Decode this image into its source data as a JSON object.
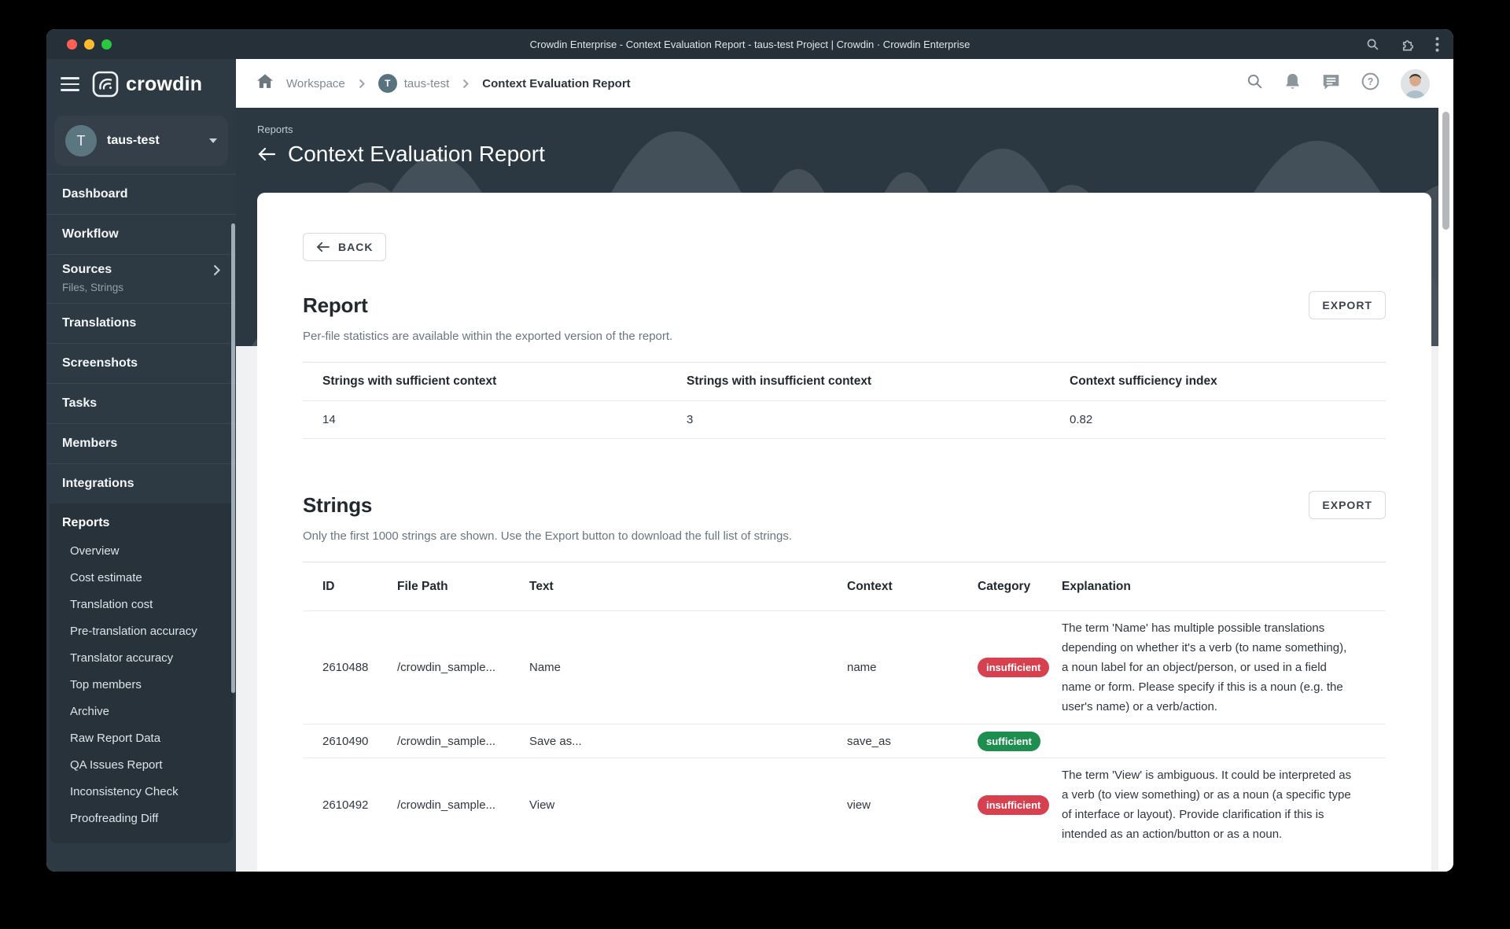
{
  "browser": {
    "title": "Crowdin Enterprise - Context Evaluation Report - taus-test Project | Crowdin · Crowdin Enterprise",
    "traffic_colors": {
      "close": "#ff5f57",
      "minimize": "#febc2e",
      "zoom": "#28c840"
    }
  },
  "app_header": {
    "breadcrumb": {
      "workspace": "Workspace",
      "project": "taus-test",
      "project_initial": "T",
      "current": "Context Evaluation Report"
    }
  },
  "sidebar": {
    "logo_text": "crowdin",
    "project": {
      "initial": "T",
      "name": "taus-test"
    },
    "items": [
      {
        "label": "Dashboard"
      },
      {
        "label": "Workflow"
      },
      {
        "label": "Sources",
        "subtitle": "Files, Strings"
      },
      {
        "label": "Translations"
      },
      {
        "label": "Screenshots"
      },
      {
        "label": "Tasks"
      },
      {
        "label": "Members"
      },
      {
        "label": "Integrations"
      }
    ],
    "reports": {
      "label": "Reports",
      "children": [
        "Overview",
        "Cost estimate",
        "Translation cost",
        "Pre-translation accuracy",
        "Translator accuracy",
        "Top members",
        "Archive",
        "Raw Report Data",
        "QA Issues Report",
        "Inconsistency Check",
        "Proofreading Diff"
      ]
    }
  },
  "page_header": {
    "eyebrow": "Reports",
    "title": "Context Evaluation Report"
  },
  "content": {
    "back_label": "BACK",
    "report": {
      "title": "Report",
      "export_label": "EXPORT",
      "subtitle": "Per-file statistics are available within the exported version of the report.",
      "stats": {
        "headers": [
          "Strings with sufficient context",
          "Strings with insufficient context",
          "Context sufficiency index"
        ],
        "values": [
          "14",
          "3",
          "0.82"
        ]
      }
    },
    "strings": {
      "title": "Strings",
      "export_label": "EXPORT",
      "subtitle": "Only the first 1000 strings are shown. Use the Export button to download the full list of strings.",
      "columns": [
        "ID",
        "File Path",
        "Text",
        "Context",
        "Category",
        "Explanation"
      ],
      "rows": [
        {
          "id": "2610488",
          "file_path": "/crowdin_sample...",
          "text": "Name",
          "context": "name",
          "category": "insufficient",
          "explanation": "The term 'Name' has multiple possible translations depending on whether it's a verb (to name something), a noun label for an object/person, or used in a field name or form. Please specify if this is a noun (e.g. the user's name) or a verb/action."
        },
        {
          "id": "2610490",
          "file_path": "/crowdin_sample...",
          "text": "Save as...",
          "context": "save_as",
          "category": "sufficient",
          "explanation": ""
        },
        {
          "id": "2610492",
          "file_path": "/crowdin_sample...",
          "text": "View",
          "context": "view",
          "category": "insufficient",
          "explanation": "The term 'View' is ambiguous. It could be interpreted as a verb (to view something) or as a noun (a specific type of interface or layout). Provide clarification if this is intended as an action/button or as a noun."
        }
      ]
    }
  },
  "colors": {
    "badge_insufficient": "#d6404f",
    "badge_sufficient": "#1d8e4e",
    "sidebar_bg": "#2d3a43",
    "banner_bg": "#2b3841"
  }
}
